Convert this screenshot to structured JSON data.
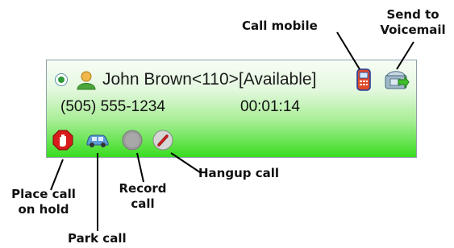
{
  "contact": {
    "name_status": "John Brown<110>[Available]",
    "phone": "(505) 555-1234",
    "duration": "00:01:14"
  },
  "annotations": {
    "call_mobile": "Call mobile",
    "send_to_voicemail": [
      "Send to",
      "Voicemail"
    ],
    "hangup_call": "Hangup call",
    "record_call": [
      "Record",
      "call"
    ],
    "place_on_hold": [
      "Place call",
      "on hold"
    ],
    "park_call": "Park call"
  },
  "icons": {
    "status": "radio-selected-icon",
    "contact": "user-avatar-icon",
    "mobile": "mobile-phone-icon",
    "voicemail": "voicemail-icon",
    "hold": "hold-hand-icon",
    "park": "park-car-icon",
    "record": "record-icon",
    "hangup": "hangup-icon"
  },
  "colors": {
    "panel_gradient_bottom": "#39dc20",
    "panel_gradient_top": "#f7fdf6",
    "hold_red": "#d81c1c",
    "panel_border": "#8fa0a8"
  }
}
